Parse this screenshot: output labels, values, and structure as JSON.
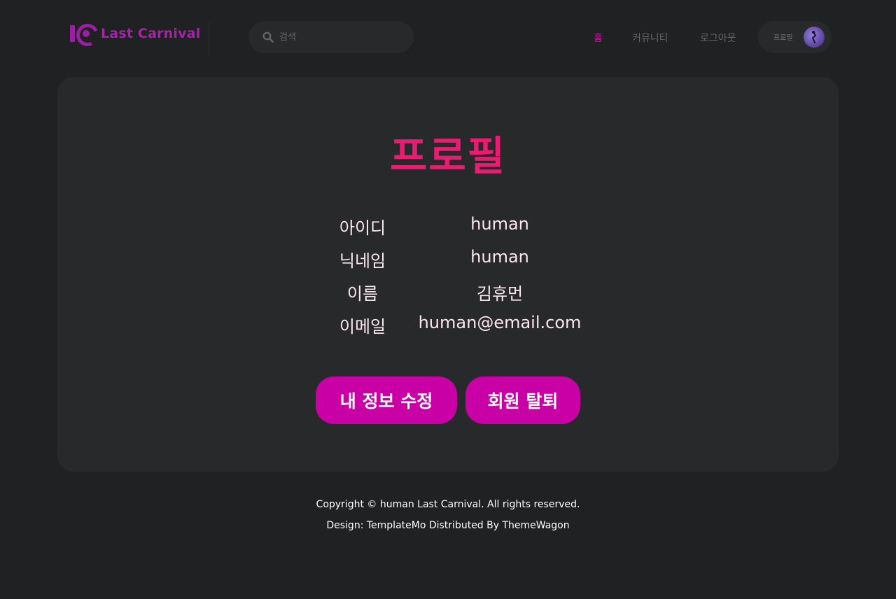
{
  "header": {
    "brand_name": "Last Carnival",
    "search_placeholder": "검색",
    "nav": [
      {
        "label": "홈",
        "active": true
      },
      {
        "label": "커뮤니티",
        "active": false
      },
      {
        "label": "로그아웃",
        "active": false
      }
    ],
    "profile_label": "프로필"
  },
  "main": {
    "title": "프로필",
    "fields": [
      {
        "label": "아이디",
        "value": "human"
      },
      {
        "label": "닉네임",
        "value": "human"
      },
      {
        "label": "이름",
        "value": "김휴먼"
      },
      {
        "label": "이메일",
        "value": "human@email.com"
      }
    ],
    "buttons": {
      "edit_label": "내 정보 수정",
      "withdraw_label": "회원 탈퇴"
    }
  },
  "footer": {
    "copyright": "Copyright © human Last Carnival. All rights reserved.",
    "credit": "Design: TemplateMo Distributed By ThemeWagon"
  },
  "colors": {
    "background": "#1f2122",
    "panel": "#27292a",
    "brand": "#a524a8",
    "title_pink": "#ec1a72",
    "button_magenta": "#c900a6",
    "nav_active": "#c0149b"
  },
  "icons": [
    "brand-logo-icon",
    "search-icon",
    "avatar"
  ]
}
